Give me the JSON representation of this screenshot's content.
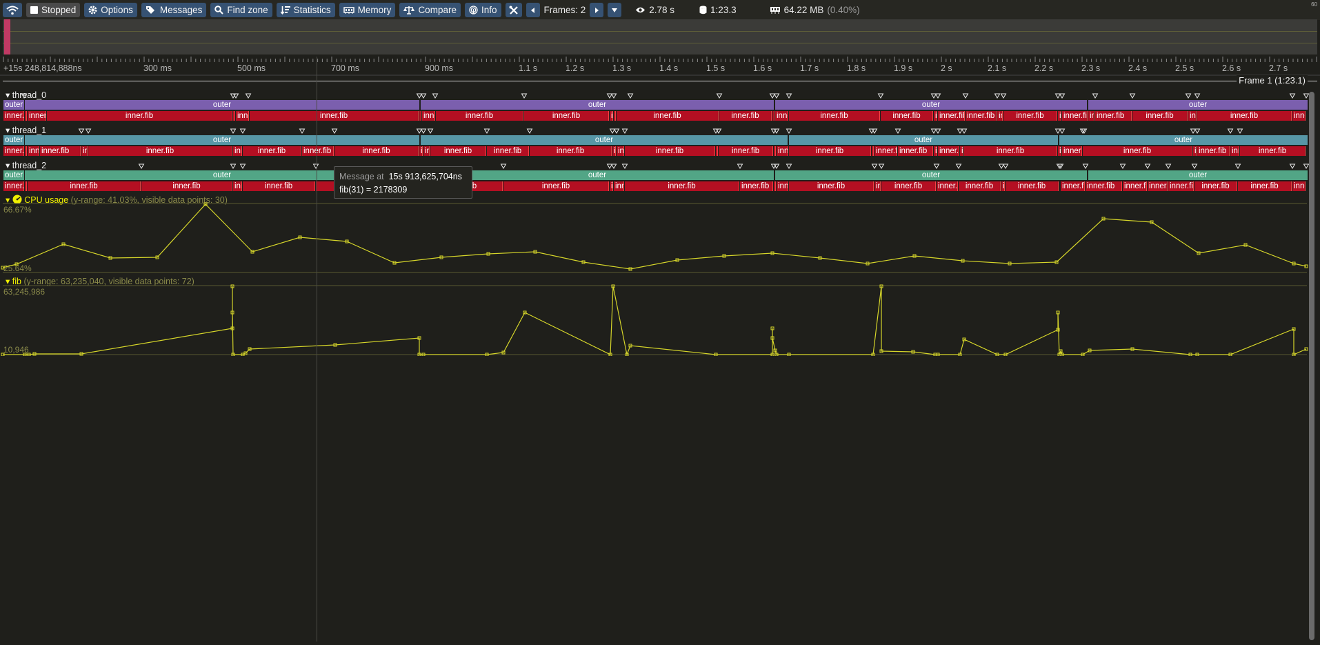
{
  "toolbar": {
    "connection_icon": "wifi-icon",
    "stopped_label": "Stopped",
    "options_label": "Options",
    "messages_label": "Messages",
    "find_zone_label": "Find zone",
    "statistics_label": "Statistics",
    "memory_label": "Memory",
    "compare_label": "Compare",
    "info_label": "Info",
    "frames_label": "Frames: 2",
    "view_time": "2.78 s",
    "total_time": "1:23.3",
    "memory_value": "64.22 MB",
    "memory_percent": "(0.40%)",
    "corner_value": "60"
  },
  "ruler": {
    "start_label": "+15s 248,814,888ns",
    "ticks": [
      "300 ms",
      "500 ms",
      "700 ms",
      "900 ms",
      "1.1 s",
      "1.2 s",
      "1.3 s",
      "1.4 s",
      "1.5 s",
      "1.6 s",
      "1.7 s",
      "1.8 s",
      "1.9 s",
      "2 s",
      "2.1 s",
      "2.2 s",
      "2.3 s",
      "2.4 s",
      "2.5 s",
      "2.6 s",
      "2.7 s"
    ]
  },
  "frame_label": "Frame 1 (1:23.1)",
  "threads": [
    {
      "name": "thread_0"
    },
    {
      "name": "thread_1"
    },
    {
      "name": "thread_2"
    }
  ],
  "zones": {
    "outer": "outer",
    "inner": "inner.fib"
  },
  "plots": {
    "cpu": {
      "title": "CPU usage",
      "meta": "(y-range: 41.03%, visible data points: 30)",
      "max_label": "66.67%",
      "min_label": "25.64%"
    },
    "fib": {
      "title": "fib",
      "meta": "(y-range: 63,235,040, visible data points: 72)",
      "max_label": "63,245,986",
      "min_label": "10,946"
    }
  },
  "tooltip": {
    "prefix": "Message at",
    "time": "15s 913,625,704ns",
    "text": "fib(31) = 2178309"
  },
  "colors": {
    "background": "#1f1f1b",
    "button": "#365273",
    "thread0": "#7b5fae",
    "thread1": "#5797a6",
    "thread2": "#52a586",
    "inner": "#b40f22",
    "plot": "#d6d62a"
  }
}
